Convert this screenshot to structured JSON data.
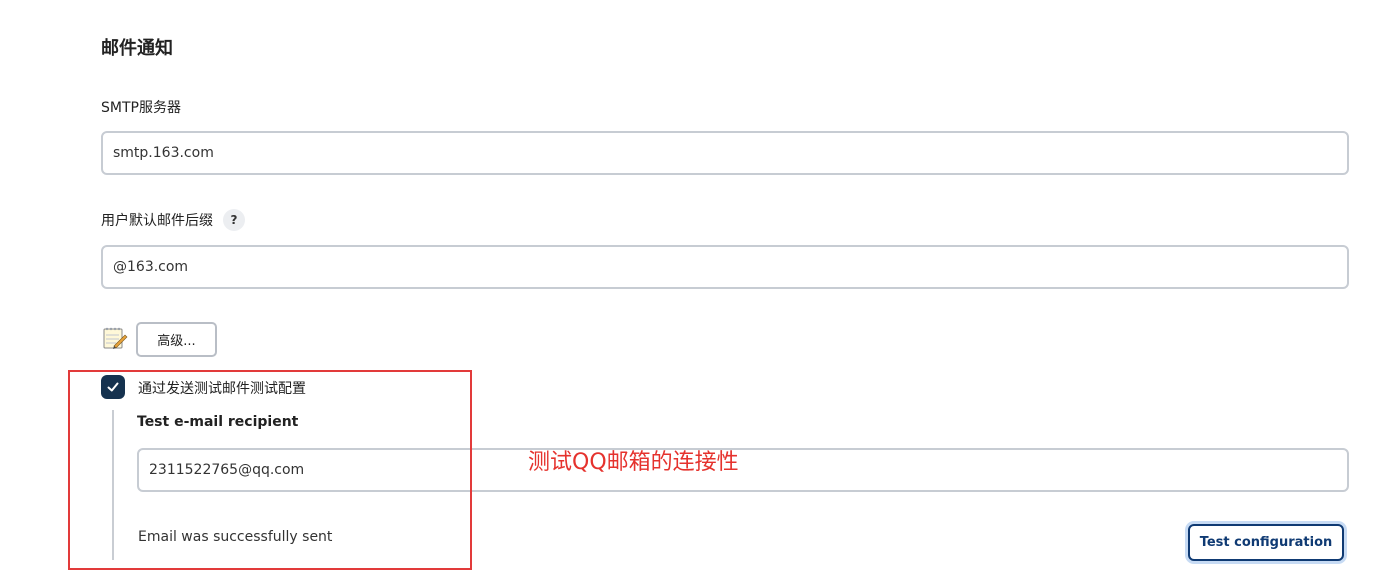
{
  "section": {
    "title": "邮件通知"
  },
  "smtp": {
    "label": "SMTP服务器",
    "value": "smtp.163.com"
  },
  "suffix": {
    "label": "用户默认邮件后缀",
    "help": "?",
    "value": "@163.com"
  },
  "advanced": {
    "icon": "notepad-icon",
    "label": "高级..."
  },
  "test_mail": {
    "checkbox_label": "通过发送测试邮件测试配置",
    "checked": true,
    "recipient_label": "Test e-mail recipient",
    "recipient_value": "2311522765@qq.com",
    "status": "Email was successfully sent",
    "button_label": "Test configuration"
  },
  "annotation": {
    "text": "测试QQ邮箱的连接性",
    "color": "#e5322d"
  },
  "colors": {
    "checkbox": "#15324f",
    "primary_button": "#0f3a73"
  }
}
